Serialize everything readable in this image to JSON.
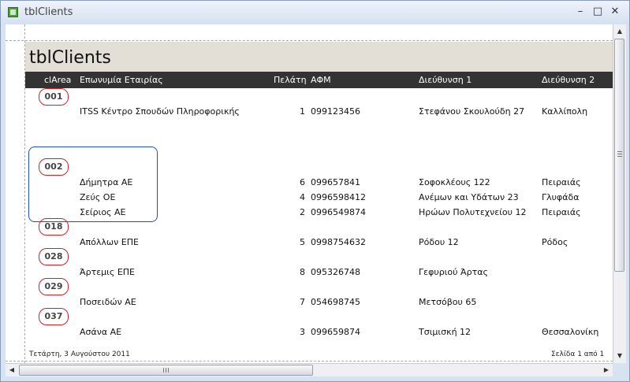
{
  "window": {
    "title": "tblClients",
    "minimize_icon": "minimize-icon",
    "maximize_icon": "maximize-icon",
    "close_icon": "close-icon"
  },
  "report": {
    "title": "tblClients",
    "columns": [
      "clArea",
      "Επωνυμία Εταιρίας",
      "Πελάτη",
      "ΑΦΜ",
      "Διεύθυνση 1",
      "Διεύθυνση 2"
    ],
    "groups": [
      {
        "area": "001",
        "rows": [
          {
            "name": "ITSS Κέντρο Σπουδών Πληροφορικής",
            "client": "1",
            "afm": "099123456",
            "addr1": "Στεφάνου Σκουλούδη 27",
            "addr2": "Καλλίπολη"
          }
        ]
      },
      {
        "area": "002",
        "rows": [
          {
            "name": "Δήμητρα ΑΕ",
            "client": "6",
            "afm": "099657841",
            "addr1": "Σοφοκλέους 122",
            "addr2": "Πειραιάς"
          },
          {
            "name": "Ζεύς ΟΕ",
            "client": "4",
            "afm": "0996598412",
            "addr1": "Ανέμων και Υδάτων 23",
            "addr2": "Γλυφάδα"
          },
          {
            "name": "Σείριος ΑΕ",
            "client": "2",
            "afm": "0996549874",
            "addr1": "Ηρώων Πολυτεχνείου 12",
            "addr2": "Πειραιάς"
          }
        ]
      },
      {
        "area": "018",
        "rows": [
          {
            "name": "Απόλλων ΕΠΕ",
            "client": "5",
            "afm": "0998754632",
            "addr1": "Ρόδου 12",
            "addr2": "Ρόδος"
          }
        ]
      },
      {
        "area": "028",
        "rows": [
          {
            "name": "Άρτεμις ΕΠΕ",
            "client": "8",
            "afm": "095326748",
            "addr1": "Γεφυριού Άρτας",
            "addr2": ""
          }
        ]
      },
      {
        "area": "029",
        "rows": [
          {
            "name": "Ποσειδών ΑΕ",
            "client": "7",
            "afm": "054698745",
            "addr1": "Μετσόβου 65",
            "addr2": ""
          }
        ]
      },
      {
        "area": "037",
        "rows": [
          {
            "name": "Ασάνα ΑΕ",
            "client": "3",
            "afm": "099659874",
            "addr1": "Τσιμισκή 12",
            "addr2": "Θεσσαλονίκη"
          }
        ]
      }
    ],
    "footer": {
      "date": "Τετάρτη, 3 Αυγούστου 2011",
      "page": "Σελίδα 1 από 1"
    }
  },
  "scrollbars": {
    "up_icon": "arrow-up-icon",
    "down_icon": "arrow-down-icon",
    "left_icon": "arrow-left-icon",
    "right_icon": "arrow-right-icon"
  }
}
